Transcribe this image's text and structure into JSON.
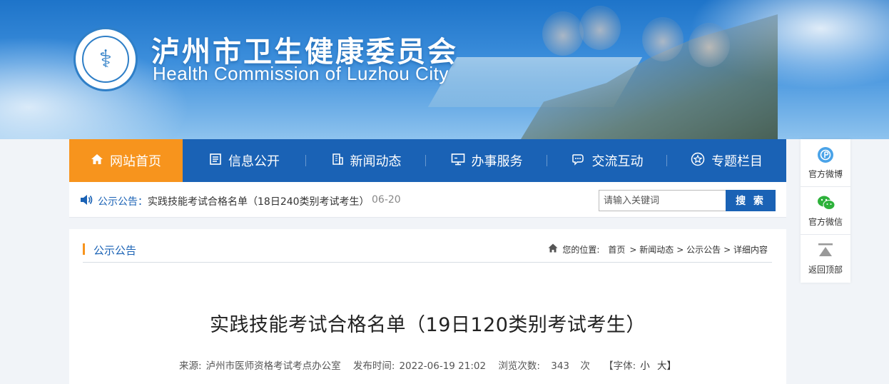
{
  "header": {
    "title": "泸州市卫生健康委员会",
    "subtitle": "Health Commission of Luzhou City"
  },
  "nav": {
    "items": [
      {
        "label": "网站首页",
        "icon": "home-icon",
        "active": true
      },
      {
        "label": "信息公开",
        "icon": "document-icon"
      },
      {
        "label": "新闻动态",
        "icon": "building-icon"
      },
      {
        "label": "办事服务",
        "icon": "monitor-icon"
      },
      {
        "label": "交流互动",
        "icon": "chat-icon"
      },
      {
        "label": "专题栏目",
        "icon": "star-icon"
      }
    ]
  },
  "notice": {
    "label": "公示公告：",
    "text": "实践技能考试合格名单（18日240类别考试考生）",
    "date": "06-20"
  },
  "search": {
    "placeholder": "请输入关键词",
    "button": "搜 索"
  },
  "column": {
    "title": "公示公告"
  },
  "breadcrumb": {
    "prefix": "您的位置:",
    "items": [
      "首页",
      "> 新闻动态",
      "> 公示公告",
      "> 详细内容"
    ]
  },
  "article": {
    "title": "实践技能考试合格名单（19日120类别考试考生）",
    "source_label": "来源:",
    "source": "泸州市医师资格考试考点办公室",
    "publish_label": "发布时间:",
    "publish_time": "2022-06-19 21:02",
    "views_label": "浏览次数:",
    "views": "343",
    "views_unit": "次",
    "font_label": "【字体:",
    "font_small": "小",
    "font_large": "大】"
  },
  "side": {
    "items": [
      {
        "label": "官方微博",
        "icon": "weibo-icon"
      },
      {
        "label": "官方微信",
        "icon": "wechat-icon"
      },
      {
        "label": "返回顶部",
        "icon": "back-to-top-icon"
      }
    ]
  },
  "colors": {
    "nav_bg": "#1a62b5",
    "nav_active": "#f7941d",
    "accent_bar": "#f7941d"
  }
}
